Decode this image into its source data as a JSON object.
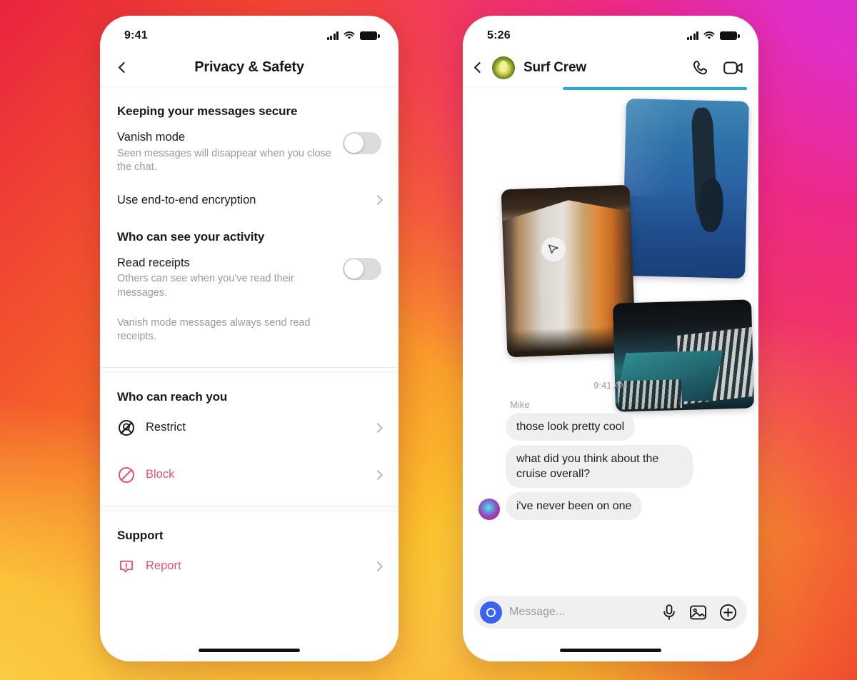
{
  "background": {
    "gradient_colors": [
      "#d62fd4",
      "#ee2a87",
      "#f1336a",
      "#ef3b36",
      "#f45f2a",
      "#fbc02d",
      "#fcd34a"
    ]
  },
  "left_phone": {
    "status": {
      "time": "9:41",
      "signal_icon": "cellular-signal-icon",
      "wifi_icon": "wifi-icon",
      "battery_icon": "battery-icon"
    },
    "nav": {
      "back_icon": "back-chevron-icon",
      "title": "Privacy & Safety"
    },
    "sections": [
      {
        "heading": "Keeping your messages secure",
        "rows": [
          {
            "type": "toggle",
            "title": "Vanish mode",
            "subtitle": "Seen messages will disappear when you close the chat.",
            "state": "off"
          },
          {
            "type": "link",
            "title": "Use end-to-end encryption",
            "chevron_icon": "chevron-right-icon"
          }
        ]
      },
      {
        "heading": "Who can see your activity",
        "rows": [
          {
            "type": "toggle",
            "title": "Read receipts",
            "subtitle": "Others can see when you've read their messages.",
            "state": "off"
          }
        ],
        "note": "Vanish mode messages always send read receipts."
      },
      {
        "heading": "Who can reach you",
        "rows": [
          {
            "type": "link",
            "title": "Restrict",
            "icon": "restrict-icon",
            "color": "#18191a",
            "chevron_icon": "chevron-right-icon"
          },
          {
            "type": "link",
            "title": "Block",
            "icon": "block-icon",
            "color": "#e0567a",
            "chevron_icon": "chevron-right-icon"
          }
        ]
      },
      {
        "heading": "Support",
        "rows": [
          {
            "type": "link",
            "title": "Report",
            "icon": "report-icon",
            "color": "#e0567a",
            "chevron_icon": "chevron-right-icon"
          }
        ]
      }
    ]
  },
  "right_phone": {
    "status": {
      "time": "5:26",
      "signal_icon": "cellular-signal-icon",
      "wifi_icon": "wifi-icon",
      "battery_icon": "battery-icon"
    },
    "nav": {
      "back_icon": "back-chevron-icon",
      "avatar_icon": "avocado-avatar",
      "title": "Surf Crew",
      "call_icon": "phone-call-icon",
      "video_icon": "video-camera-icon"
    },
    "media": {
      "share_icon": "send-share-icon",
      "photos": [
        {
          "name": "photo-underwater-diver"
        },
        {
          "name": "photo-hotel-room-curtains"
        },
        {
          "name": "photo-ship-pool-deck"
        }
      ]
    },
    "timestamp": "9:41 AM",
    "sender_name": "Mike",
    "messages": [
      {
        "text": "those look pretty cool",
        "avatar": false
      },
      {
        "text": "what did you think about the cruise overall?",
        "avatar": false
      },
      {
        "text": "i've never been on one",
        "avatar": true,
        "avatar_icon": "mike-profile-avatar"
      }
    ],
    "composer": {
      "camera_icon": "camera-icon",
      "placeholder": "Message...",
      "mic_icon": "microphone-icon",
      "gallery_icon": "photo-gallery-icon",
      "plus_icon": "plus-circle-icon"
    }
  }
}
